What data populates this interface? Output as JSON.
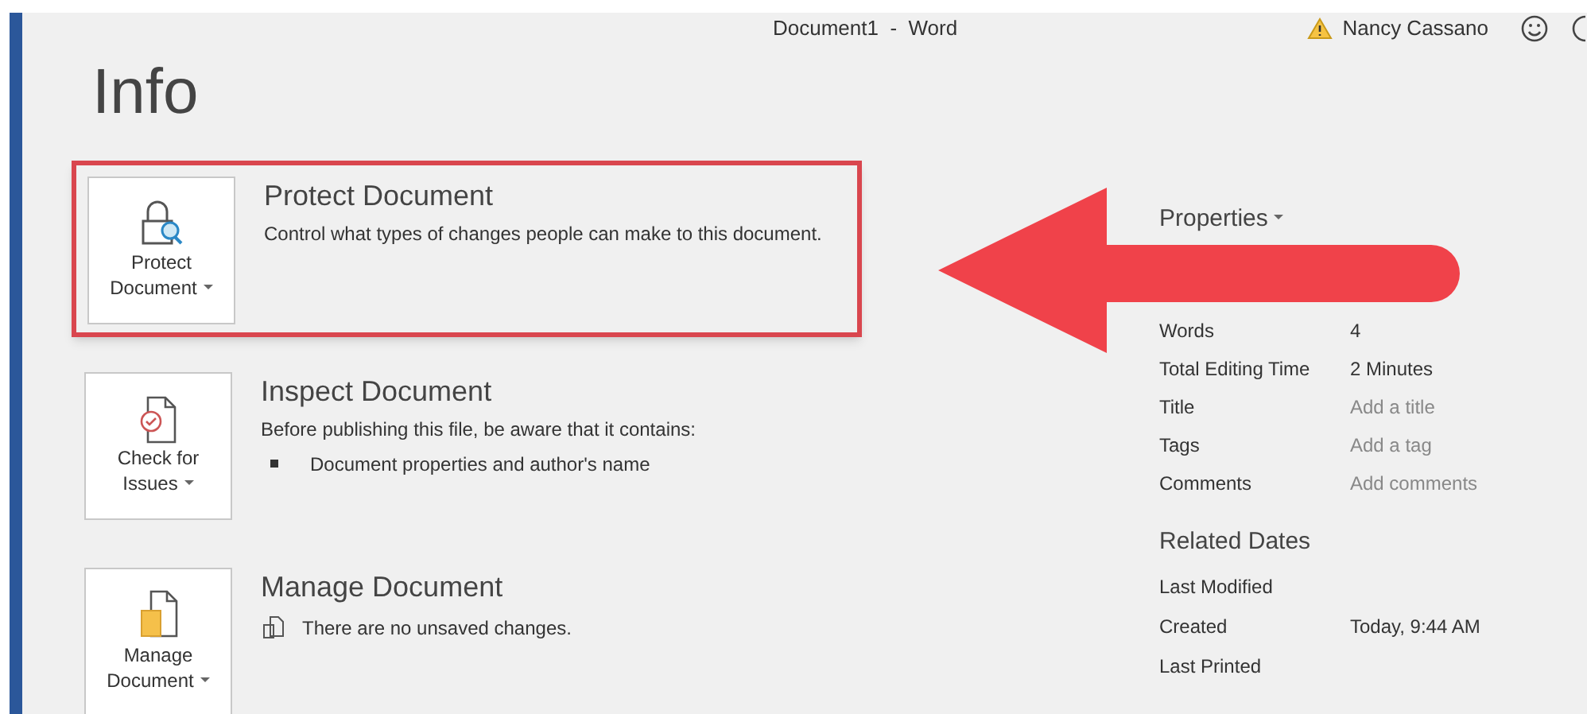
{
  "window": {
    "title": "Document1  -  Word",
    "user": "Nancy Cassano"
  },
  "page_title": "Info",
  "sections": [
    {
      "kind": "protect",
      "button_line1": "Protect",
      "button_line2": "Document",
      "heading": "Protect Document",
      "description": "Control what types of changes people can make to this document.",
      "highlighted": true
    },
    {
      "kind": "inspect",
      "button_line1": "Check for",
      "button_line2": "Issues",
      "heading": "Inspect Document",
      "description": "Before publishing this file, be aware that it contains:",
      "bullets": [
        "Document properties and author's name"
      ],
      "highlighted": false
    },
    {
      "kind": "manage",
      "button_line1": "Manage",
      "button_line2": "Document",
      "heading": "Manage Document",
      "note": "There are no unsaved changes.",
      "highlighted": false
    }
  ],
  "properties": {
    "heading": "Properties",
    "rows": [
      {
        "label": "Words",
        "value": "4",
        "placeholder": false
      },
      {
        "label": "Total Editing Time",
        "value": "2 Minutes",
        "placeholder": false
      },
      {
        "label": "Title",
        "value": "Add a title",
        "placeholder": true
      },
      {
        "label": "Tags",
        "value": "Add a tag",
        "placeholder": true
      },
      {
        "label": "Comments",
        "value": "Add comments",
        "placeholder": true
      }
    ]
  },
  "related_dates": {
    "heading": "Related Dates",
    "rows": [
      {
        "label": "Last Modified"
      },
      {
        "label": "Created",
        "value": "Today, 9:44 AM"
      },
      {
        "label": "Last Printed"
      }
    ]
  }
}
